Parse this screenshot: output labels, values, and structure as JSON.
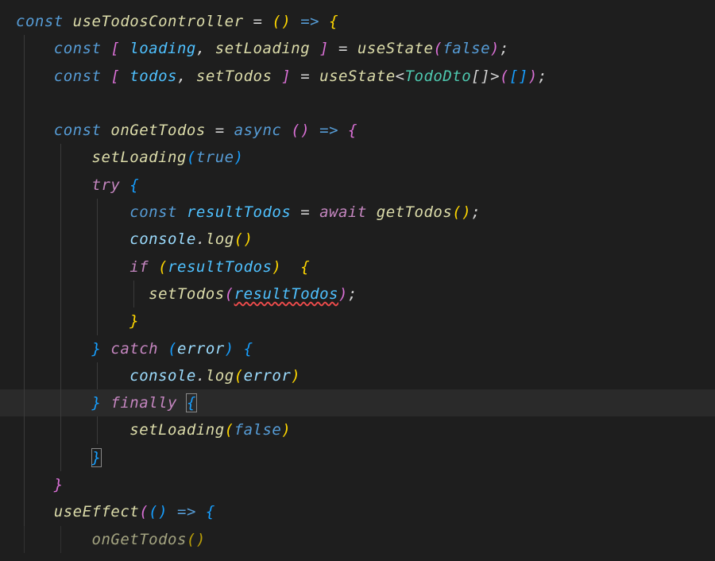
{
  "code": {
    "l1": {
      "const": "const",
      "fn": "useTodosController",
      "eq": " = ",
      "paren_o": "(",
      "paren_c": ")",
      "arrow": " => ",
      "brace_o": "{"
    },
    "l2": {
      "indent": "    ",
      "const": "const",
      "br_o": " [ ",
      "v1": "loading",
      "comma": ", ",
      "v2": "setLoading",
      "br_c": " ] ",
      "eq": "= ",
      "fn": "useState",
      "paren_o": "(",
      "val": "false",
      "paren_c": ")",
      "semi": ";"
    },
    "l3": {
      "indent": "    ",
      "const": "const",
      "br_o": " [ ",
      "v1": "todos",
      "comma": ", ",
      "v2": "setTodos",
      "br_c": " ] ",
      "eq": "= ",
      "fn": "useState",
      "lt": "<",
      "type": "TodoDto",
      "arr": "[]",
      "gt": ">",
      "paren_o": "(",
      "arr_o": "[",
      "arr_c": "]",
      "paren_c": ")",
      "semi": ";"
    },
    "l5": {
      "indent": "    ",
      "const": "const",
      "sp": " ",
      "fn": "onGetTodos",
      "eq": " = ",
      "async": "async",
      "sp2": " ",
      "paren_o": "(",
      "paren_c": ")",
      "arrow": " => ",
      "brace_o": "{"
    },
    "l6": {
      "indent": "        ",
      "fn": "setLoading",
      "paren_o": "(",
      "val": "true",
      "paren_c": ")"
    },
    "l7": {
      "indent": "        ",
      "try": "try",
      "sp": " ",
      "brace_o": "{"
    },
    "l8": {
      "indent": "            ",
      "const": "const",
      "sp": " ",
      "var": "resultTodos",
      "eq": " = ",
      "await": "await",
      "sp2": " ",
      "fn": "getTodos",
      "paren_o": "(",
      "paren_c": ")",
      "semi": ";"
    },
    "l9": {
      "indent": "            ",
      "obj": "console",
      "dot": ".",
      "fn": "log",
      "paren_o": "(",
      "paren_c": ")"
    },
    "l10": {
      "indent": "            ",
      "if": "if",
      "sp": " ",
      "paren_o": "(",
      "var": "resultTodos",
      "paren_c": ")",
      "sp2": "  ",
      "brace_o": "{"
    },
    "l11": {
      "indent": "              ",
      "fn": "setTodos",
      "paren_o": "(",
      "var": "resultTodos",
      "paren_c": ")",
      "semi": ";"
    },
    "l12": {
      "indent": "            ",
      "brace_c": "}"
    },
    "l13": {
      "indent": "        ",
      "brace_c": "}",
      "sp": " ",
      "catch": "catch",
      "sp2": " ",
      "paren_o": "(",
      "var": "error",
      "paren_c": ")",
      "sp3": " ",
      "brace_o": "{"
    },
    "l14": {
      "indent": "            ",
      "obj": "console",
      "dot": ".",
      "fn": "log",
      "paren_o": "(",
      "var": "error",
      "paren_c": ")"
    },
    "l15": {
      "indent": "        ",
      "brace_c": "}",
      "sp": " ",
      "finally": "finally",
      "sp2": " ",
      "brace_o": "{"
    },
    "l16": {
      "indent": "            ",
      "fn": "setLoading",
      "paren_o": "(",
      "val": "false",
      "paren_c": ")"
    },
    "l17": {
      "indent": "        ",
      "brace_c": "}"
    },
    "l18": {
      "indent": "    ",
      "brace_c": "}"
    },
    "l19": {
      "indent": "    ",
      "fn": "useEffect",
      "paren_o": "(",
      "paren2_o": "(",
      "paren2_c": ")",
      "arrow": " => ",
      "brace_o": "{"
    },
    "l20": {
      "indent": "        ",
      "fn": "onGetTodos",
      "paren_o": "(",
      "paren_c": ")"
    }
  }
}
